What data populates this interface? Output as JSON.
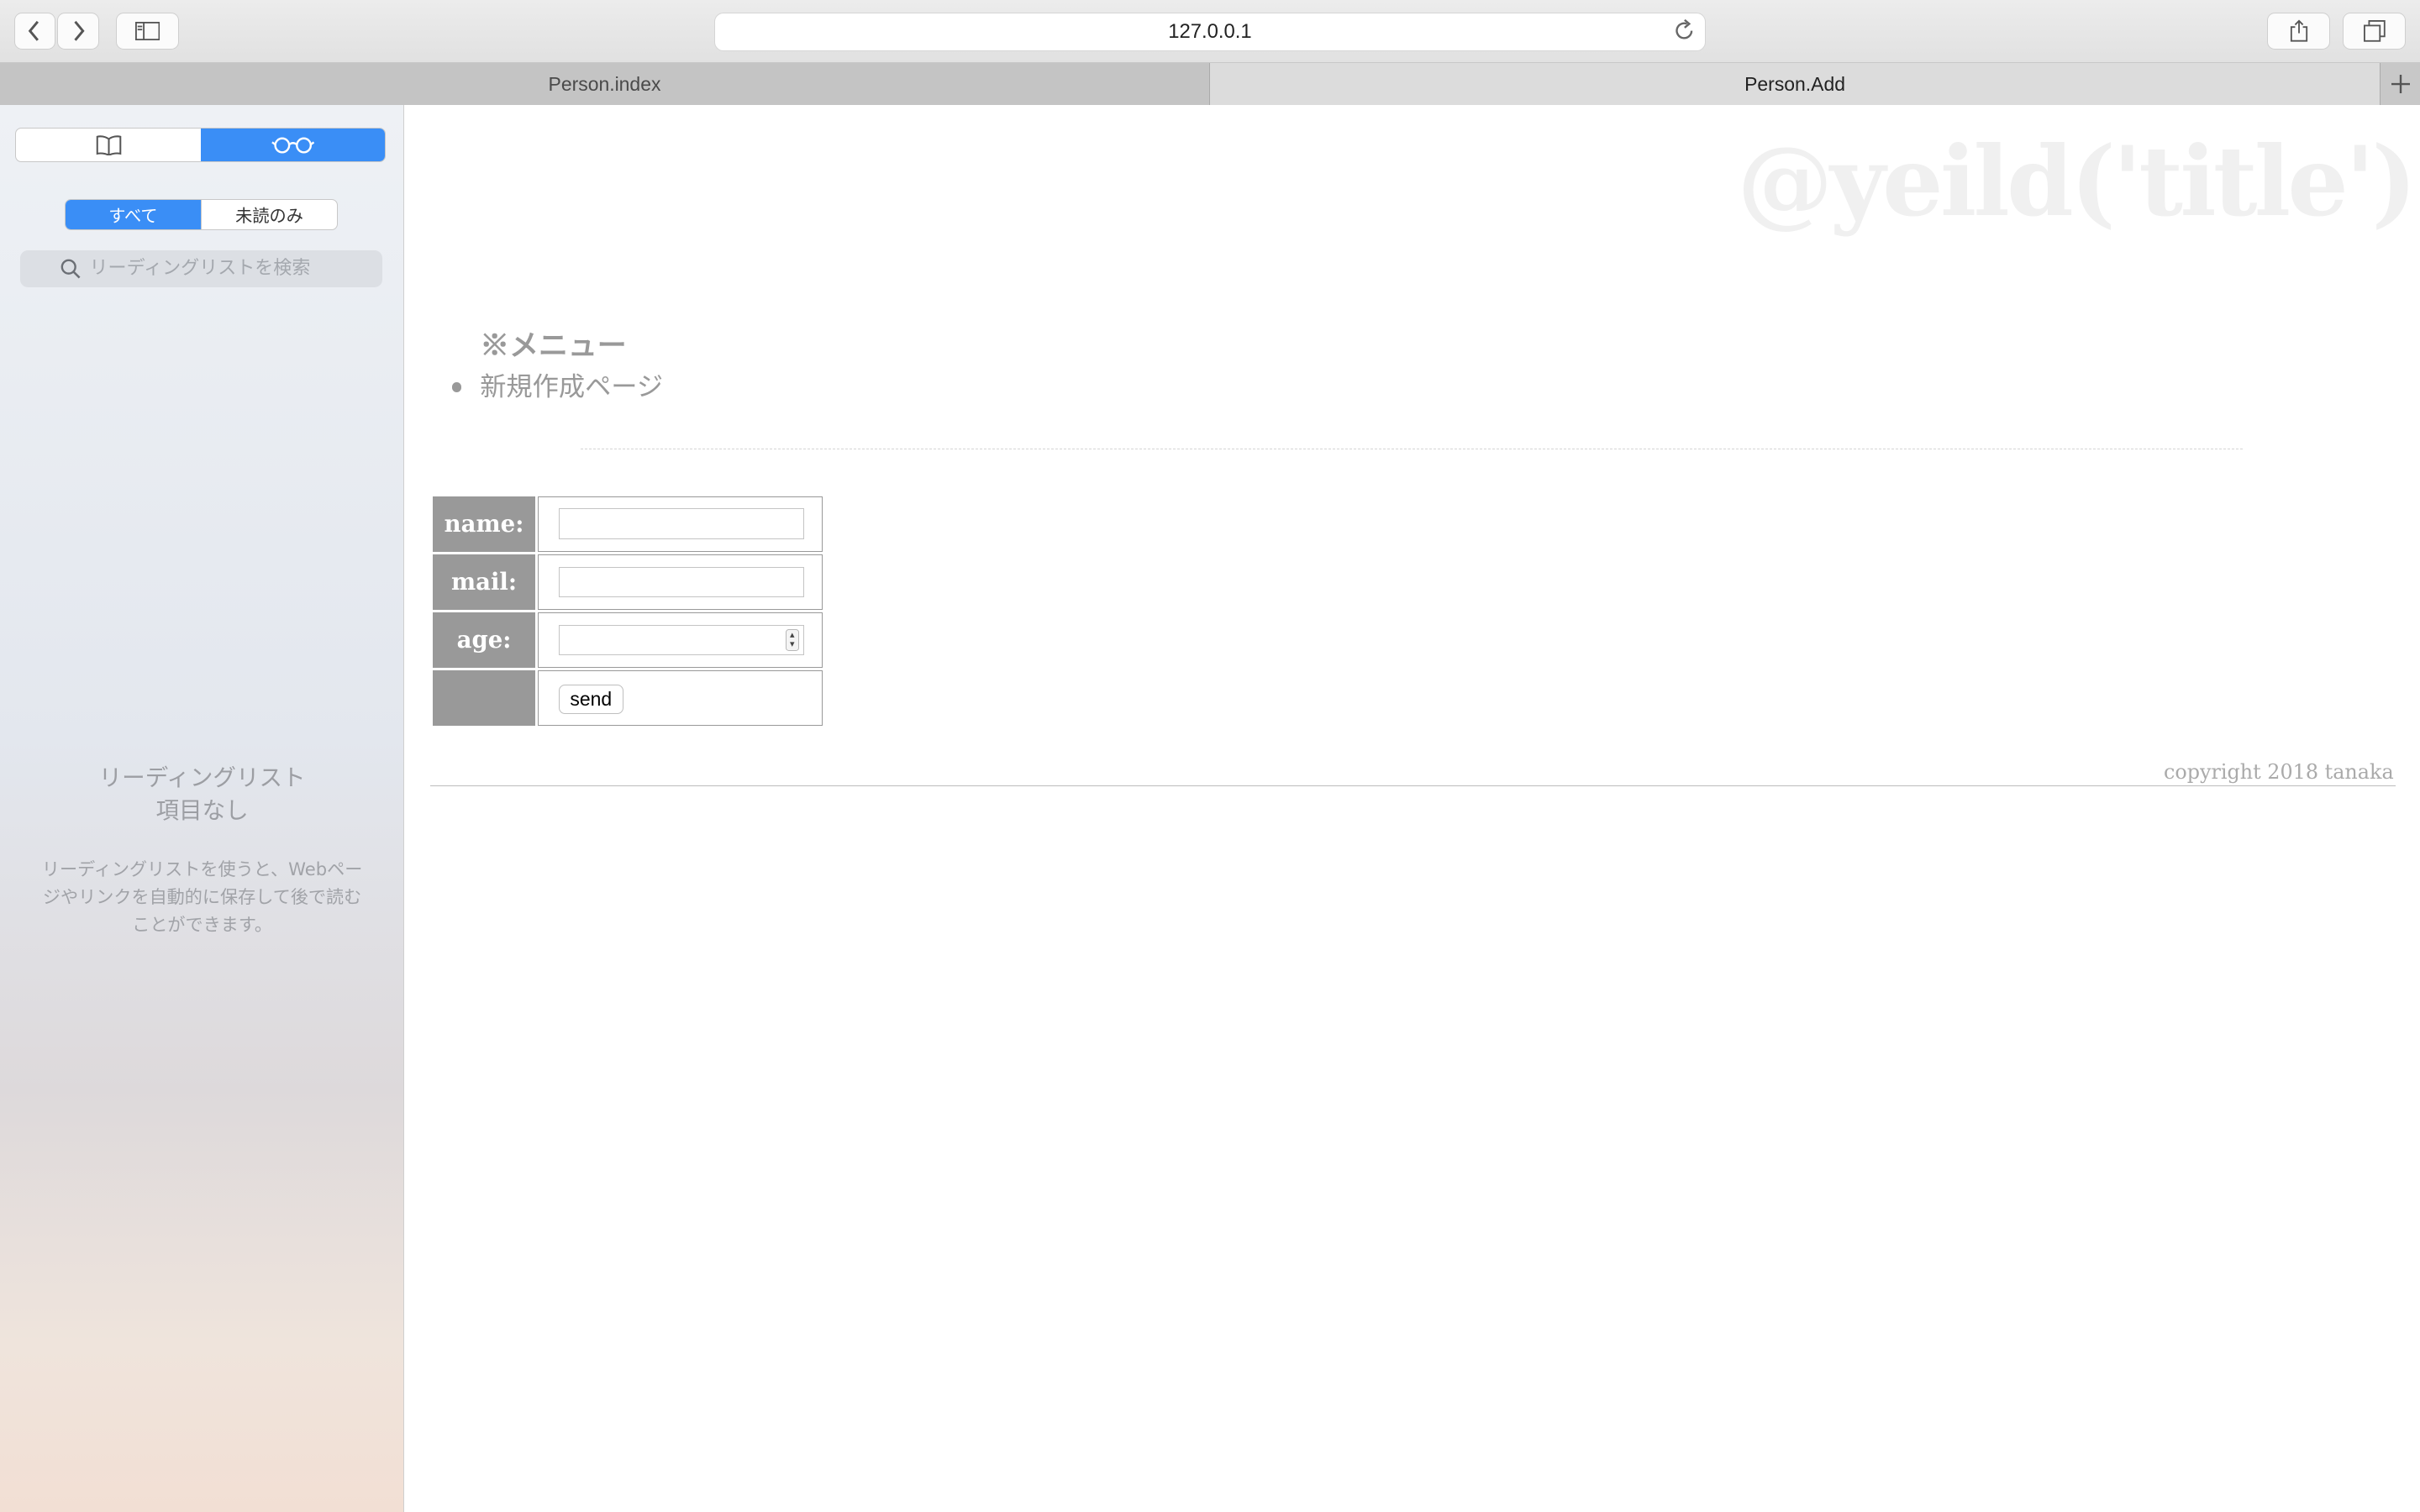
{
  "browser": {
    "url": "127.0.0.1",
    "tabs": [
      {
        "label": "Person.index",
        "active": false
      },
      {
        "label": "Person.Add",
        "active": true
      }
    ]
  },
  "sidebar": {
    "filter_all": "すべて",
    "filter_unread": "未読のみ",
    "search_placeholder": "リーディングリストを検索",
    "empty_title_line1": "リーディングリスト",
    "empty_title_line2": "項目なし",
    "empty_description": "リーディングリストを使うと、Webページやリンクを自動的に保存して後で読むことができます。",
    "accent_color": "#3a8ef6"
  },
  "page": {
    "heading": "@yeild('title')",
    "menu_title": "※メニュー",
    "menu_items": [
      "新規作成ページ"
    ],
    "form": {
      "name_label": "name:",
      "name_value": "",
      "mail_label": "mail:",
      "mail_value": "",
      "age_label": "age:",
      "age_value": "",
      "send_label": "send"
    },
    "footer": "copyright 2018 tanaka"
  }
}
